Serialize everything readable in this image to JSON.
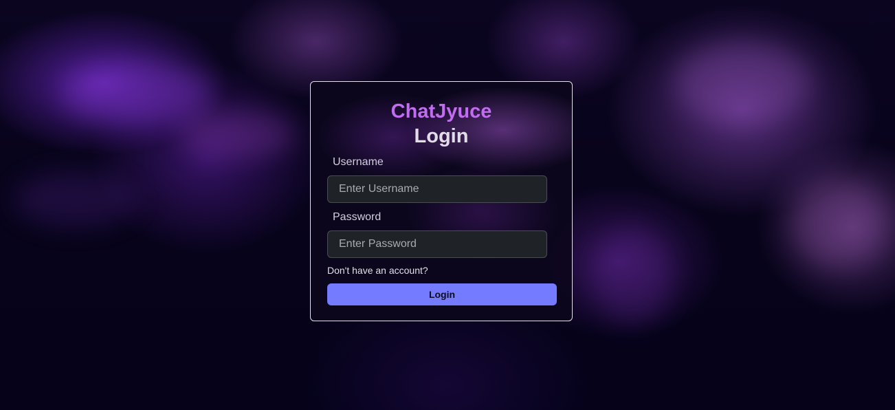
{
  "brand": {
    "name": "ChatJyuce",
    "color": "#c26cf0"
  },
  "form": {
    "title": "Login",
    "username": {
      "label": "Username",
      "placeholder": "Enter Username",
      "value": ""
    },
    "password": {
      "label": "Password",
      "placeholder": "Enter Password",
      "value": ""
    },
    "signup_link": "Don't have an account?",
    "submit_label": "Login",
    "submit_color": "#757bff"
  },
  "background": {
    "theme": "purple smoke on dark"
  }
}
